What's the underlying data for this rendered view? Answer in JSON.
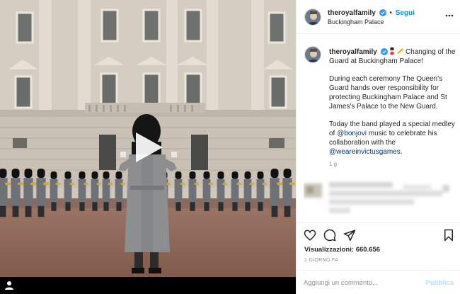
{
  "media": {
    "type": "video"
  },
  "header": {
    "username": "theroyalfamily",
    "follow_label": "Segui",
    "location": "Buckingham Palace"
  },
  "caption": {
    "username": "theroyalfamily",
    "title_text": "Changing of the Guard at Buckingham Palace!",
    "paragraph1": "During each ceremony The Queen's Guard hands over responsibility for protecting Buckingham Palace and St James's Palace to the New Guard.",
    "paragraph2_pre": "Today the band played a special medley of ",
    "mention1": "@bonjovi",
    "paragraph2_mid": " music to celebrate his collaboration with the ",
    "mention2": "@weareinvictusgames",
    "paragraph2_end": ".",
    "time": "1 g"
  },
  "stats": {
    "views_label": "Visualizzazioni:",
    "views_value": "660.656",
    "time_ago": "1 GIORNO FA"
  },
  "comment": {
    "placeholder": "Aggiungi un commento...",
    "publish_label": "Pubblica"
  },
  "colors": {
    "accent": "#0095f6",
    "verified": "#3897f0",
    "publish_disabled": "#b2dffc"
  }
}
